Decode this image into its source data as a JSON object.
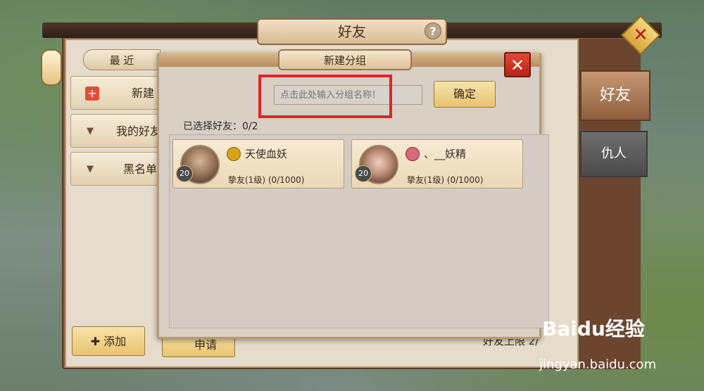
{
  "main": {
    "title": "好友",
    "help": "?",
    "close": "✕"
  },
  "left": {
    "recent_tab": "最 近",
    "rows": [
      {
        "label": "新建"
      },
      {
        "label": "我的好友"
      },
      {
        "label": "黑名单"
      }
    ],
    "add_button": "添加",
    "apply_button": "申请"
  },
  "right_tabs": {
    "friends": "好友",
    "enemies": "仇人"
  },
  "limit_text": "好友上限 2/",
  "dialog": {
    "title": "新建分组",
    "close": "✕",
    "input_placeholder": "点击此处输入分组名称！",
    "confirm": "确定",
    "selected": "已选择好友：0/2",
    "friends": [
      {
        "name": "天使血妖",
        "level": "20",
        "relation": "挚友(1级) (0/1000)"
      },
      {
        "name": "、__妖精",
        "level": "20",
        "relation": "挚友(1级) (0/1000)"
      }
    ]
  },
  "watermark": {
    "brand": "Baidu经验",
    "url": "jingyan.baidu.com"
  }
}
